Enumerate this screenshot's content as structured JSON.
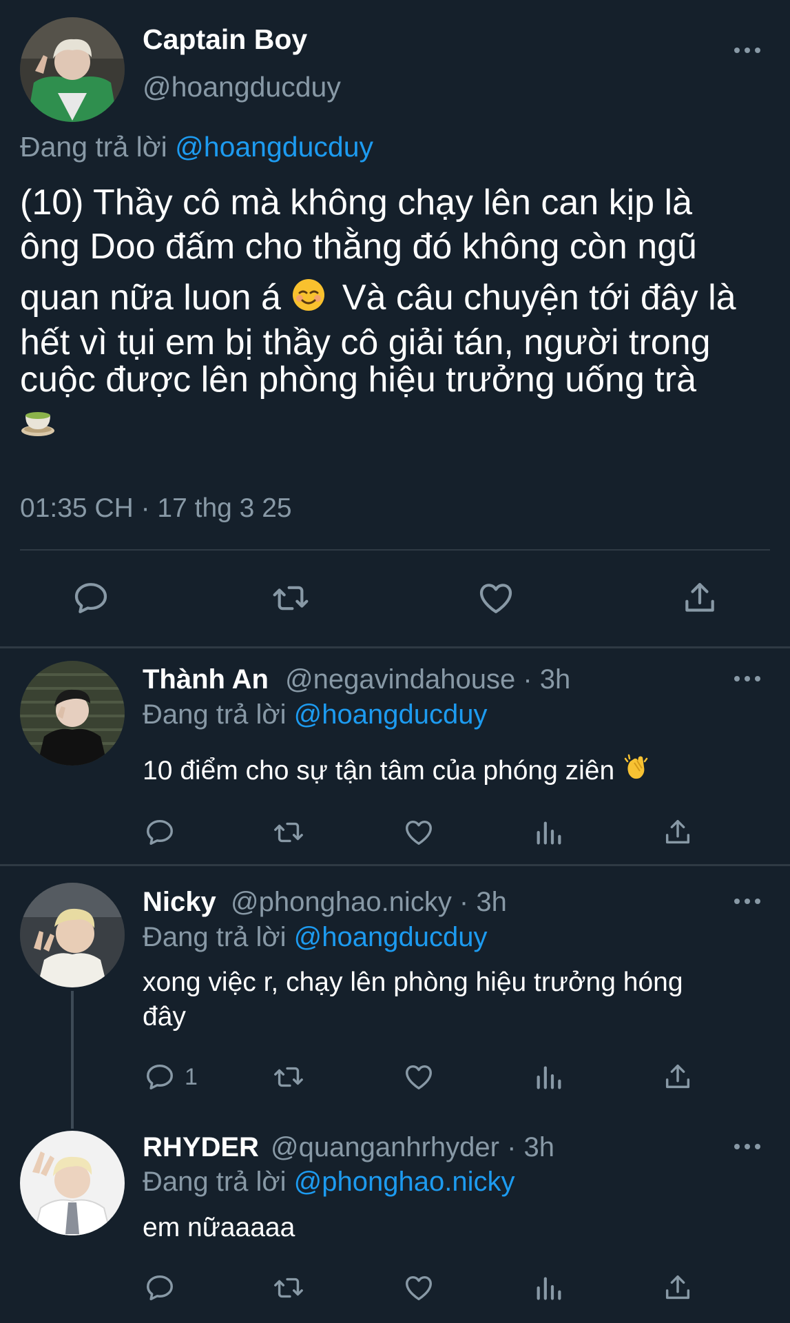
{
  "main": {
    "name": "Captain Boy",
    "handle": "@hoangducduy",
    "replying_label": "Đang trả lời",
    "replying_to": "@hoangducduy",
    "text_lines": [
      "(10) Thầy cô mà không chạy lên can kịp là",
      "ông Doo đấm cho thằng đó không còn ngũ",
      "quan nữa luon á",
      "Và câu chuyện tới đây là",
      "hết vì tụi em bị thầy cô giải tán, người trong",
      "cuộc được lên phòng hiệu trưởng uống trà"
    ],
    "timestamp": "01:35 CH · 17 thg 3 25"
  },
  "replies": [
    {
      "name": "Thành An",
      "handle": "@negavindahouse · 3h",
      "replying_label": "Đang trả lời",
      "replying_to": "@hoangducduy",
      "text": "10 điểm cho sự tận tâm của phóng ziên"
    },
    {
      "name": "Nicky",
      "handle": "@phonghao.nicky · 3h",
      "replying_label": "Đang trả lời",
      "replying_to": "@hoangducduy",
      "text_lines": [
        "xong việc r, chạy lên phòng hiệu trưởng hóng",
        "đây"
      ],
      "reply_count": "1"
    },
    {
      "name": "RHYDER",
      "handle": "@quanganhrhyder · 3h",
      "replying_label": "Đang trả lời",
      "replying_to": "@phonghao.nicky",
      "text": "em nữaaaaa"
    }
  ],
  "icons": [
    "reply-icon",
    "retweet-icon",
    "like-icon",
    "share-icon",
    "analytics-icon",
    "more-icon"
  ],
  "colors": {
    "background": "#15202b",
    "secondary_text": "#8899a6",
    "link": "#1d9bf0",
    "divider": "#2f3a44"
  }
}
